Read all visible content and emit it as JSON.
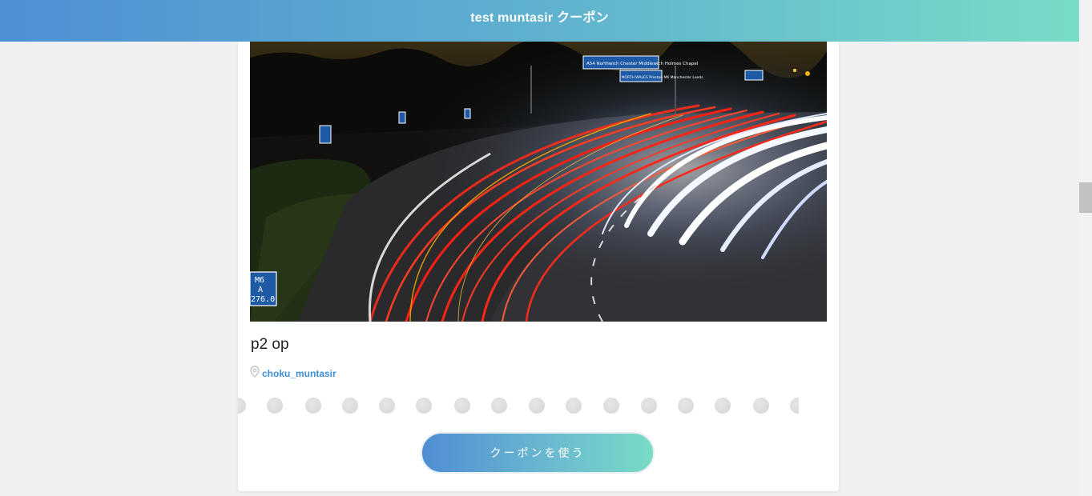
{
  "header": {
    "title": "test muntasir クーポン"
  },
  "coupon": {
    "title": "p2 op",
    "location_name": "choku_muntasir",
    "use_button_label": "クーポンを使う",
    "stamp_slots": 16
  },
  "hero": {
    "sign_top_1": "A54  Northwich Chester Middlewich Holmes Chapel",
    "sign_top_2": "NORTH WALES  Preston  M6  Manchester  Leeds",
    "sign_left_1": "M6",
    "sign_left_2": "A",
    "sign_left_3": "276.0"
  },
  "colors": {
    "header_gradient_start": "#4d8fd4",
    "header_gradient_end": "#79dcc6",
    "link_blue": "#3d8fd6"
  }
}
